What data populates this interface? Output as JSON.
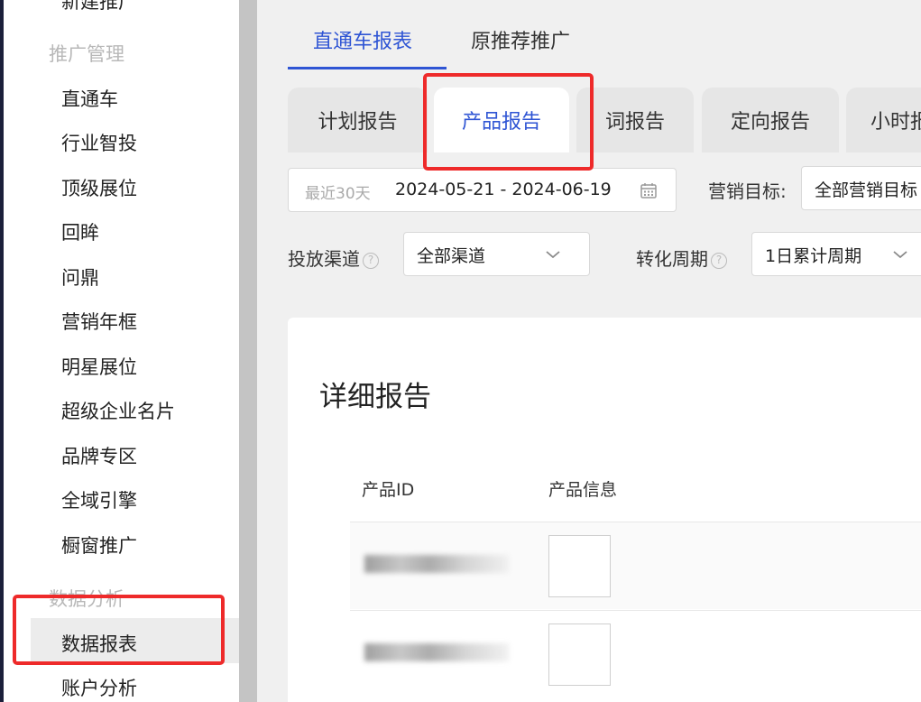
{
  "sidebar": {
    "top_item": "新建推广",
    "group_promo": "推广管理",
    "items": [
      "直通车",
      "行业智投",
      "顶级展位",
      "回眸",
      "问鼎",
      "营销年框",
      "明星展位",
      "超级企业名片",
      "品牌专区",
      "全域引擎",
      "橱窗推广"
    ],
    "group_data": "数据分析",
    "active_item": "数据报表",
    "last_item": "账户分析"
  },
  "top_tabs": [
    {
      "label": "直通车报表",
      "active": true
    },
    {
      "label": "原推荐推广",
      "active": false
    }
  ],
  "report_tabs": [
    {
      "label": "计划报告",
      "active": false
    },
    {
      "label": "产品报告",
      "active": true
    },
    {
      "label": "词报告",
      "active": false
    },
    {
      "label": "定向报告",
      "active": false
    },
    {
      "label": "小时报",
      "active": false
    }
  ],
  "filters": {
    "date_preset": "最近30天",
    "date_range": "2024-05-21 - 2024-06-19",
    "marketing_goal_label": "营销目标:",
    "marketing_goal_value": "全部营销目标",
    "channel_label": "投放渠道",
    "channel_value": "全部渠道",
    "conversion_label": "转化周期",
    "conversion_value": "1日累计周期"
  },
  "report": {
    "title": "详细报告",
    "columns": [
      "产品ID",
      "产品信息"
    ],
    "rows": [
      {
        "product_id": "",
        "thumbnail": "blank"
      },
      {
        "product_id": "",
        "thumbnail": "blank"
      }
    ]
  },
  "colors": {
    "accent": "#2f55d4",
    "highlight": "#ee2a2a"
  }
}
